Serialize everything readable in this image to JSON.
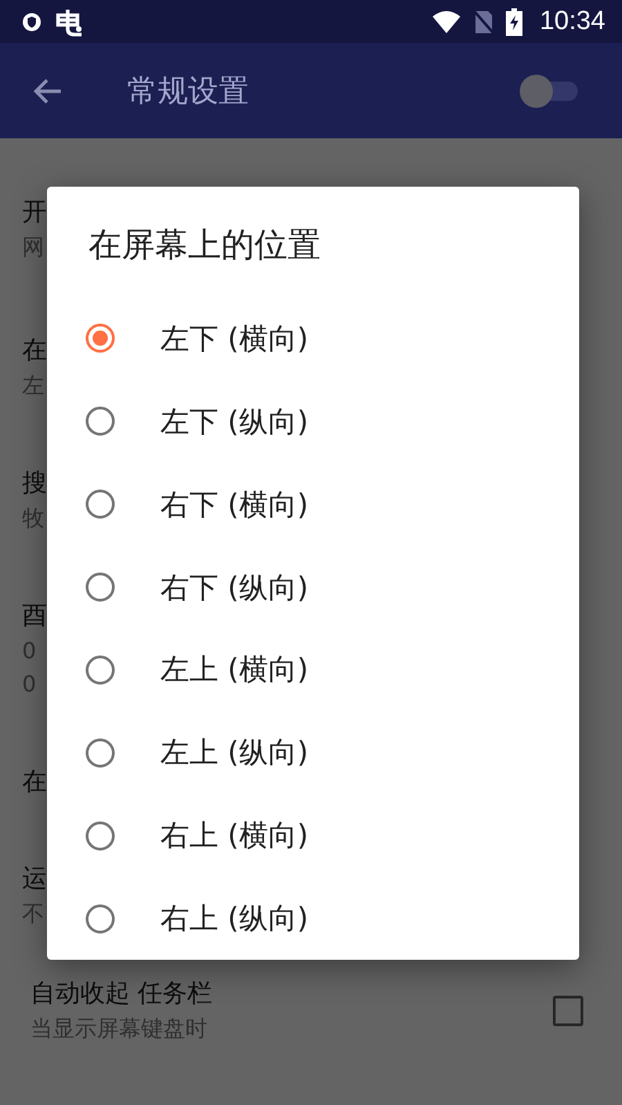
{
  "status_bar": {
    "time": "10:34"
  },
  "app_bar": {
    "title": "常规设置",
    "toggle": {
      "on": false
    }
  },
  "settings": [
    {
      "title": "开",
      "subtitle": [
        "网"
      ]
    },
    {
      "title": "在",
      "subtitle": [
        "左"
      ]
    },
    {
      "title": "搜",
      "subtitle": [
        "牧"
      ]
    },
    {
      "title": "酉",
      "subtitle": [
        "0",
        "0"
      ]
    },
    {
      "title": "在"
    },
    {
      "title": "运",
      "subtitle": [
        "不"
      ]
    },
    {
      "title": "自动收起 任务栏",
      "subtitle": [
        "当显示屏幕键盘时"
      ],
      "checked": false
    }
  ],
  "dialog": {
    "title": "在屏幕上的位置",
    "options": [
      {
        "label": "左下 (横向)",
        "selected": true
      },
      {
        "label": "左下 (纵向)",
        "selected": false
      },
      {
        "label": "右下 (横向)",
        "selected": false
      },
      {
        "label": "右下 (纵向)",
        "selected": false
      },
      {
        "label": "左上 (横向)",
        "selected": false
      },
      {
        "label": "左上 (纵向)",
        "selected": false
      },
      {
        "label": "右上 (横向)",
        "selected": false
      },
      {
        "label": "右上 (纵向)",
        "selected": false
      }
    ]
  }
}
